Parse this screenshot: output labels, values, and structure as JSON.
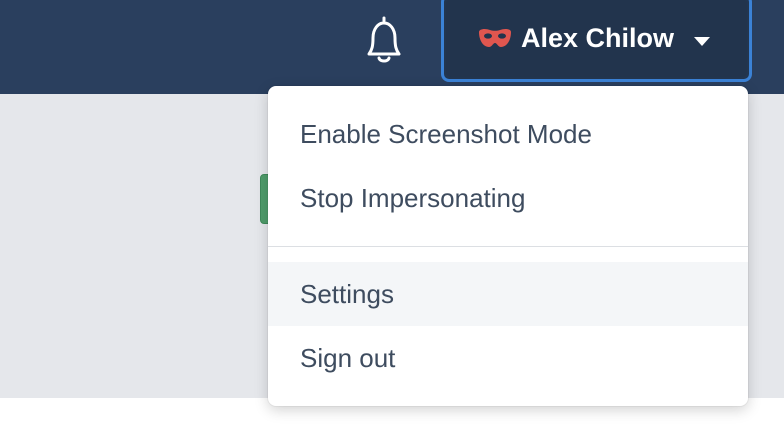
{
  "header": {
    "user_button": {
      "name": "Alex Chilow",
      "impersonation_icon": "mask-icon",
      "caret_icon": "caret-down-icon"
    },
    "notifications_icon": "bell-icon"
  },
  "user_menu": {
    "items": [
      {
        "label": "Enable Screenshot Mode"
      },
      {
        "label": "Stop Impersonating"
      },
      {
        "label": "Settings"
      },
      {
        "label": "Sign out"
      }
    ],
    "hovered_item": "Settings"
  },
  "colors": {
    "topbar": "#2a3f5e",
    "user_button_bg": "#22344d",
    "user_button_focus_ring": "#3b82d6",
    "mask_icon": "#e0564f",
    "menu_text": "#3e4c5f",
    "content_bg": "#e5e7eb",
    "green_button": "#4f9d6b"
  }
}
